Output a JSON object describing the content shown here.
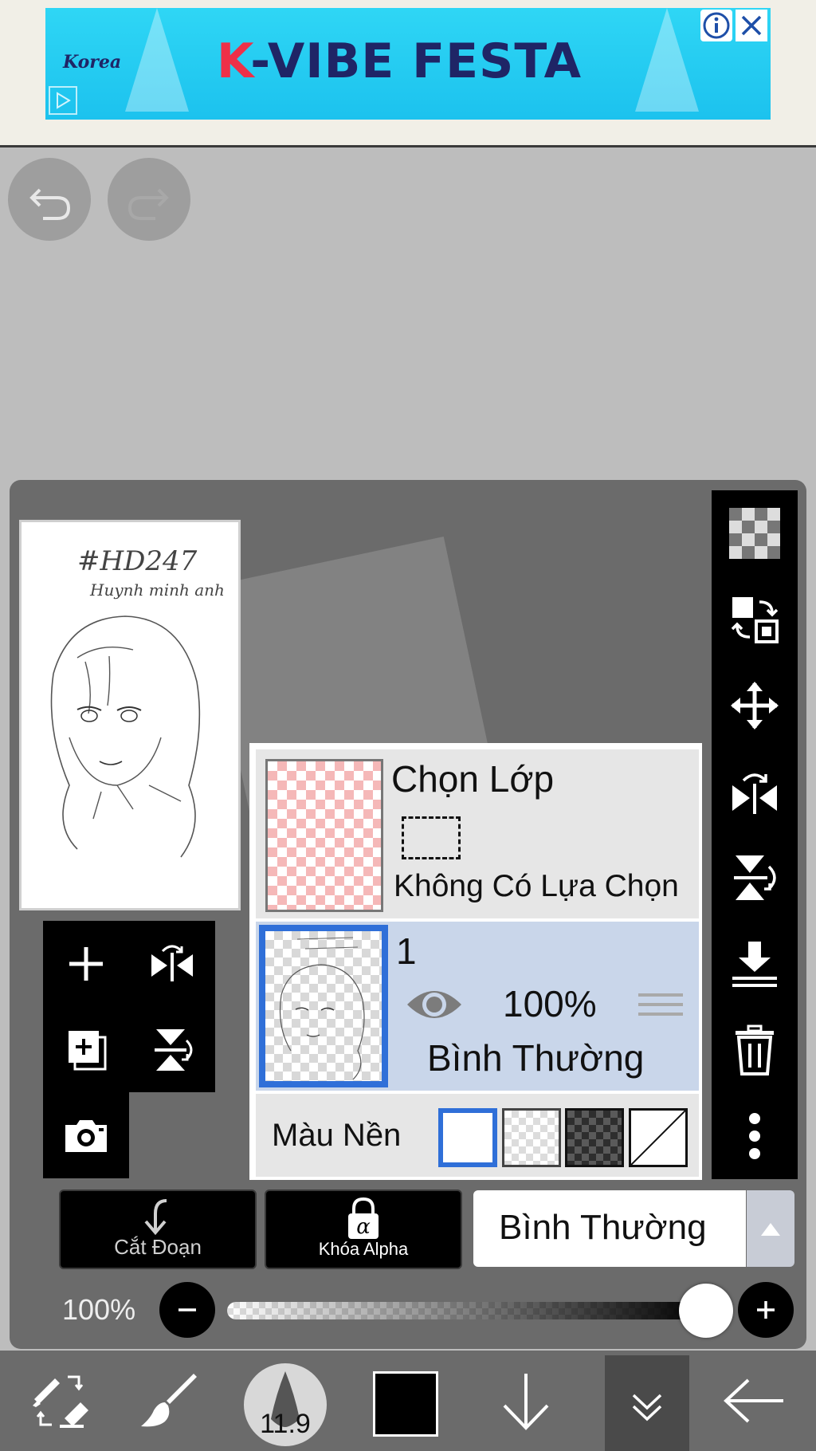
{
  "ad": {
    "title_first_letter": "K",
    "title_rest": "-VIBE FESTA",
    "logo_text": "Korea"
  },
  "history": {
    "undo_icon": "undo-icon",
    "redo_icon": "redo-icon"
  },
  "preview": {
    "handwriting_line1": "#HD247",
    "handwriting_line2": "Huynh minh anh"
  },
  "layer_panel": {
    "selection_layer": {
      "title": "Chọn Lớp",
      "status": "Không Có Lựa Chọn"
    },
    "layers": [
      {
        "name": "1",
        "visible": true,
        "opacity": "100%",
        "blend_mode": "Bình Thường"
      }
    ],
    "background": {
      "label": "Màu Nền",
      "options": [
        "white",
        "transparent",
        "dark-checker",
        "none"
      ],
      "selected": "white"
    }
  },
  "controls": {
    "clipping_label": "Cắt Đoạn",
    "alpha_lock_label": "Khóa Alpha",
    "blend_mode": "Bình Thường",
    "opacity_label": "100%",
    "opacity_value": 1.0
  },
  "left_tools": [
    "add-layer-icon",
    "flip-horizontal-icon",
    "add-layer-copy-icon",
    "flip-vertical-icon",
    "camera-icon"
  ],
  "right_tools": [
    "checker-icon",
    "transfer-icon",
    "move-icon",
    "flip-horizontal-icon",
    "flip-vertical-icon",
    "merge-down-icon",
    "trash-icon",
    "more-icon"
  ],
  "bottom_bar": {
    "brush_size": "11.9",
    "current_color": "#000000",
    "tools": [
      "tool-switch-icon",
      "brush-icon",
      "brush-size",
      "color-swatch",
      "down-arrow-icon",
      "layers-icon",
      "back-arrow-icon"
    ]
  },
  "colors": {
    "accent": "#2f6fd8",
    "panel": "#6b6b6b",
    "canvas_bg": "#bdbdbd",
    "selected_layer_bg": "#c9d6ea"
  }
}
